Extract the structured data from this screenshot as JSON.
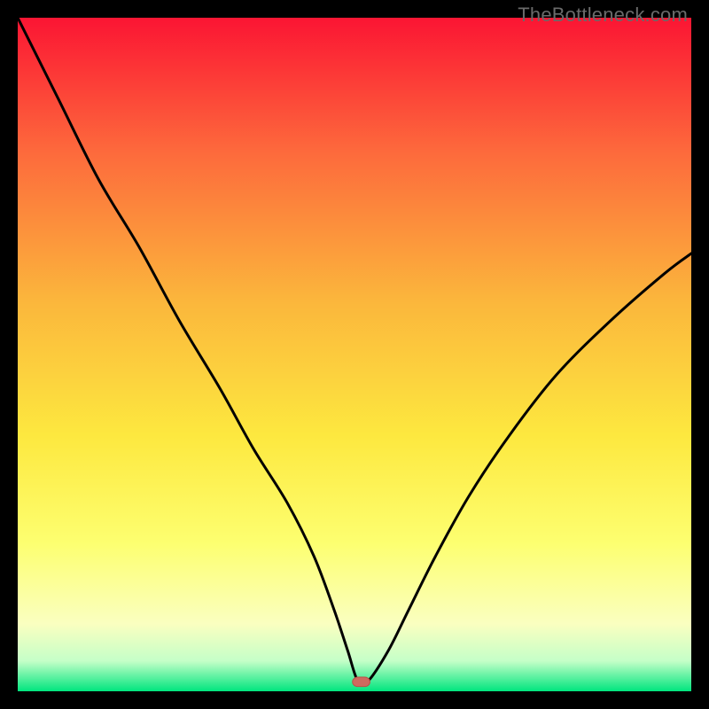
{
  "watermark": "TheBottleneck.com",
  "colors": {
    "gradient_top": "#fb1533",
    "gradient_mid1": "#fd6a3c",
    "gradient_mid2": "#fbb63c",
    "gradient_mid3": "#fde83f",
    "gradient_mid4": "#fdff70",
    "gradient_mid5": "#faffc0",
    "gradient_bottom1": "#c5ffc8",
    "gradient_bottom2": "#00e57e",
    "curve": "#000000",
    "marker_fill": "#cf6a5f",
    "marker_stroke": "#b85448"
  },
  "chart_data": {
    "type": "line",
    "title": "",
    "xlabel": "",
    "ylabel": "",
    "xlim": [
      0,
      100
    ],
    "ylim": [
      0,
      100
    ],
    "series": [
      {
        "name": "bottleneck-curve",
        "x": [
          0,
          6,
          12,
          18,
          24,
          30,
          35,
          40,
          44,
          47,
          49,
          50.5,
          52,
          55,
          58,
          62,
          67,
          73,
          80,
          88,
          96,
          100
        ],
        "y": [
          100,
          88,
          76,
          66,
          55,
          45,
          36,
          28,
          20,
          12,
          6,
          1.5,
          1.5,
          6,
          12,
          20,
          29,
          38,
          47,
          55,
          62,
          65
        ]
      }
    ],
    "markers": [
      {
        "name": "optimal-point",
        "x": 51,
        "y": 1.4,
        "shape": "rounded-rect",
        "width_pct": 2.6,
        "height_pct": 1.4
      }
    ]
  }
}
